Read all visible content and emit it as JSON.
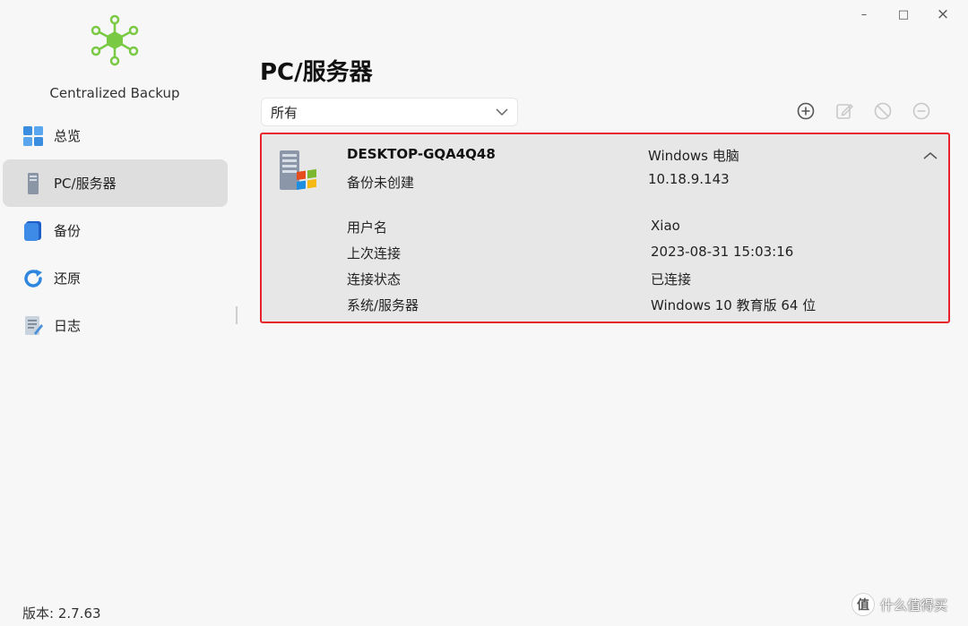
{
  "app": {
    "name": "Centralized Backup",
    "version_label": "版本: 2.7.63",
    "brand_color": "#7ac943",
    "window_controls": {
      "minimize": "–",
      "maximize": "□",
      "close": "×"
    }
  },
  "sidebar": {
    "items": [
      {
        "label": "总览",
        "icon": "dashboard-grid-icon",
        "active": false
      },
      {
        "label": "PC/服务器",
        "icon": "server-tower-icon",
        "active": true
      },
      {
        "label": "备份",
        "icon": "backup-book-icon",
        "active": false
      },
      {
        "label": "还原",
        "icon": "restore-circle-icon",
        "active": false
      },
      {
        "label": "日志",
        "icon": "log-document-icon",
        "active": false
      }
    ]
  },
  "main": {
    "title": "PC/服务器",
    "filter": {
      "selected": "所有",
      "icon": "chevron-down-icon"
    },
    "toolbar": [
      {
        "name": "add-button",
        "icon": "plus-circle-icon",
        "enabled": true
      },
      {
        "name": "edit-button",
        "icon": "edit-icon",
        "enabled": false
      },
      {
        "name": "disable-button",
        "icon": "block-icon",
        "enabled": false
      },
      {
        "name": "remove-button",
        "icon": "minus-circle-icon",
        "enabled": false
      }
    ]
  },
  "device": {
    "name": "DESKTOP-GQA4Q48",
    "backup_status": "备份未创建",
    "type": "Windows 电脑",
    "ip": "10.18.9.143",
    "highlight_color": "#e8232b",
    "details": [
      {
        "key": "用户名",
        "value": "Xiao"
      },
      {
        "key": "上次连接",
        "value": "2023-08-31 15:03:16"
      },
      {
        "key": "连接状态",
        "value": "已连接"
      },
      {
        "key": "系统/服务器",
        "value": "Windows 10 教育版 64 位"
      }
    ]
  },
  "watermark": {
    "mark": "值",
    "text": "什么值得买"
  }
}
